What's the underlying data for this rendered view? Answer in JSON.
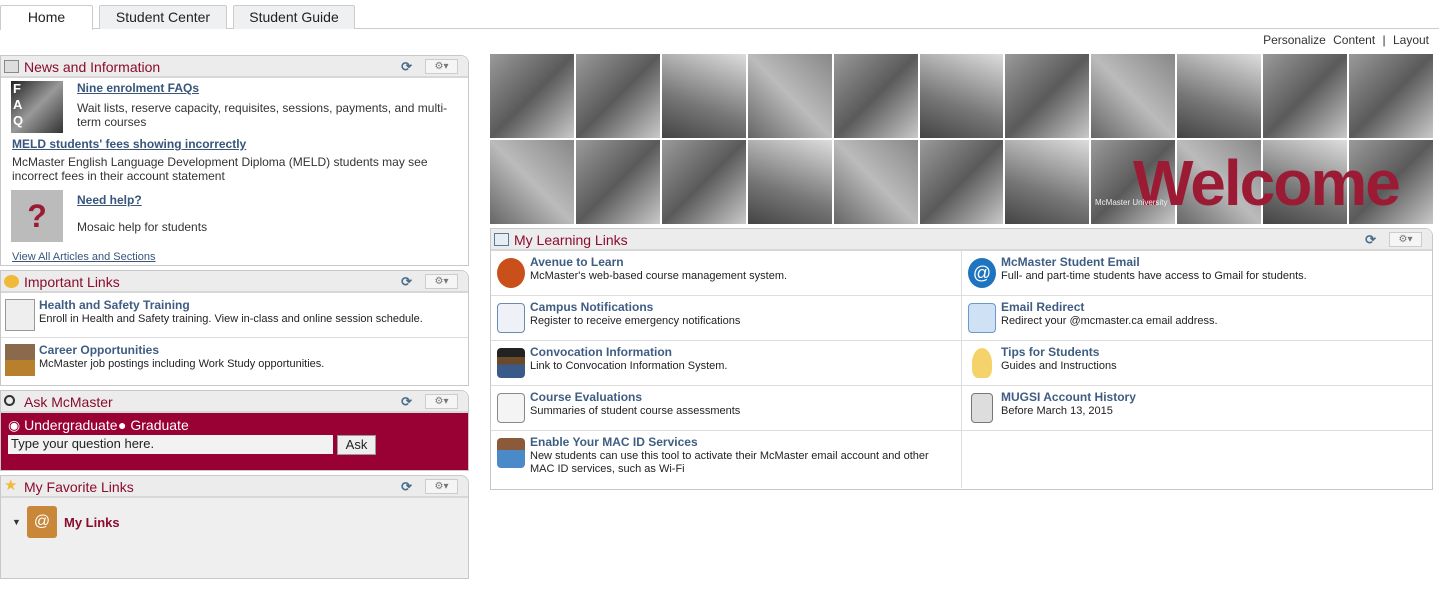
{
  "tabs": [
    "Home",
    "Student Center",
    "Student Guide"
  ],
  "personalize": {
    "label": "Personalize",
    "content": "Content",
    "sep": "|",
    "layout": "Layout"
  },
  "news": {
    "title": "News and Information",
    "items": [
      {
        "title": "Nine enrolment FAQs",
        "desc": "Wait lists, reserve capacity, requisites, sessions, payments, and multi-term courses"
      },
      {
        "title": "MELD students' fees showing incorrectly",
        "desc": "McMaster English Language Development Diploma (MELD) students may see incorrect fees in their account statement"
      },
      {
        "title": "Need help?",
        "desc": "Mosaic help for students"
      }
    ],
    "view_all": "View All Articles and Sections"
  },
  "important": {
    "title": "Important Links",
    "items": [
      {
        "title": "Health and Safety Training",
        "desc": "Enroll in Health and Safety training. View in-class and online session schedule."
      },
      {
        "title": "Career Opportunities",
        "desc": "McMaster job postings including Work Study opportunities."
      }
    ]
  },
  "ask": {
    "title": "Ask McMaster",
    "radio1": "Undergraduate",
    "radio2": "Graduate",
    "input": "Type your question here.",
    "button": "Ask"
  },
  "fav": {
    "title": "My Favorite Links",
    "my_links": "My Links"
  },
  "banner": {
    "welcome": "Welcome",
    "caption": "McMaster University"
  },
  "learning": {
    "title": "My Learning Links",
    "items": [
      {
        "title": "Avenue to Learn",
        "desc": "McMaster's web-based course management system."
      },
      {
        "title": "McMaster Student Email",
        "desc": "Full- and part-time students have access to Gmail for students."
      },
      {
        "title": "Campus Notifications",
        "desc": "Register to receive emergency notifications"
      },
      {
        "title": "Email Redirect",
        "desc": "Redirect your @mcmaster.ca email address."
      },
      {
        "title": "Convocation Information",
        "desc": "Link to Convocation Information System."
      },
      {
        "title": "Tips for Students",
        "desc": "Guides and Instructions"
      },
      {
        "title": "Course Evaluations",
        "desc": "Summaries of student course assessments"
      },
      {
        "title": "MUGSI Account History",
        "desc": "Before March 13, 2015"
      },
      {
        "title": "Enable Your MAC ID Services",
        "desc": "New students can use this tool to activate their McMaster email account and other MAC ID services, such as Wi-Fi"
      }
    ]
  }
}
